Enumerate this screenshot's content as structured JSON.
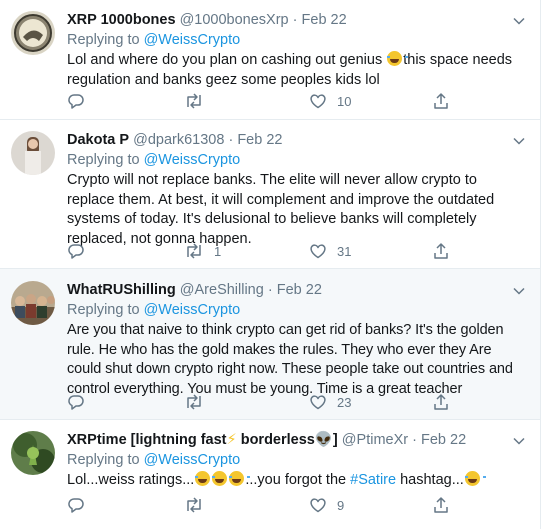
{
  "colors": {
    "link": "#1b95e0",
    "muted": "#657786",
    "text": "#14171a",
    "highlight_bg": "#f5f8fa",
    "border": "#e6ecf0"
  },
  "tweets": [
    {
      "display_name": "XRP 1000bones",
      "handle": "@1000bonesXrp",
      "date": "Feb 22",
      "replying_label": "Replying to",
      "replying_to": "@WeissCrypto",
      "text_part1": "Lol and where do you plan on cashing out genius ",
      "text_part2": "this space needs regulation and banks geez some peoples kids lol",
      "retweets": "",
      "likes": "10",
      "avatar_icon": "avatar-photo-icon"
    },
    {
      "display_name": "Dakota P",
      "handle": "@dpark61308",
      "date": "Feb 22",
      "replying_label": "Replying to",
      "replying_to": "@WeissCrypto",
      "text": "Crypto will not replace banks. The elite will never allow crypto to replace them. At best, it will complement and improve the outdated systems of today. It's delusional to believe banks will completely replaced, not gonna happen.",
      "retweets": "1",
      "likes": "31",
      "avatar_icon": "avatar-photo-icon"
    },
    {
      "display_name": "WhatRUShilling",
      "handle": "@AreShilling",
      "date": "Feb 22",
      "replying_label": "Replying to",
      "replying_to": "@WeissCrypto",
      "text": "Are you that naive to think crypto can get rid of banks? It's the golden rule. He who has the gold makes the rules. They who ever they Are could shut down crypto right now. These people take out countries and control everything. You must be young. Time is a great teacher",
      "retweets": "",
      "likes": "23",
      "avatar_icon": "avatar-photo-icon"
    },
    {
      "display_name_part1": "XRPtime [lightning fast",
      "display_name_part2": " borderless",
      "display_name_part3": "]",
      "handle": "@PtimeXr",
      "date": "Feb 22",
      "replying_label": "Replying to",
      "replying_to": "@WeissCrypto",
      "text_part1": "Lol...weiss ratings...",
      "text_part2": "...you forgot the ",
      "hashtag": "#Satire",
      "text_part3": " hashtag...",
      "retweets": "",
      "likes": "9",
      "avatar_icon": "avatar-photo-icon"
    }
  ],
  "dot": "·",
  "bolt_glyph": "⚡",
  "alien_glyph": "👽"
}
